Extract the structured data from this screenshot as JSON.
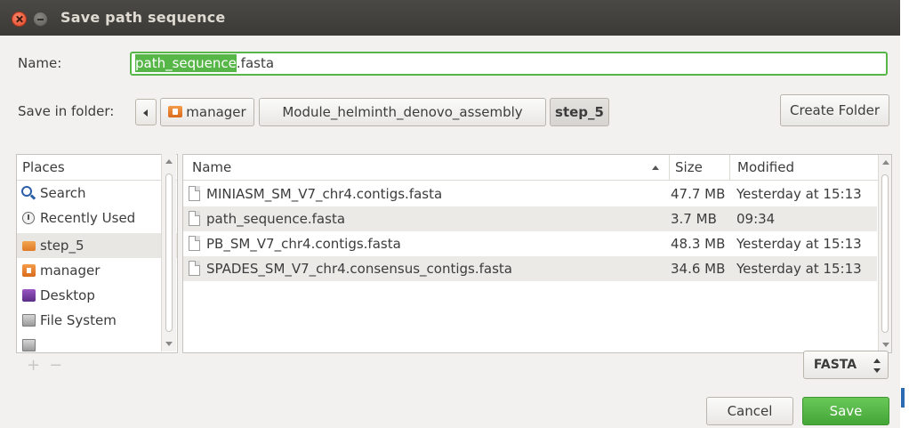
{
  "window": {
    "title": "Save path sequence"
  },
  "name_field": {
    "label": "Name:",
    "selected_part": "path_sequence",
    "rest": ".fasta"
  },
  "folder": {
    "label": "Save in folder:",
    "crumbs": [
      "manager",
      "Module_helminth_denovo_assembly",
      "step_5"
    ],
    "create_folder_label": "Create Folder"
  },
  "places": {
    "header": "Places",
    "items": [
      {
        "label": "Search",
        "icon": "search-icon"
      },
      {
        "label": "Recently Used",
        "icon": "recent-icon"
      },
      {
        "label": "step_5",
        "icon": "folder-icon"
      },
      {
        "label": "manager",
        "icon": "home-folder-icon"
      },
      {
        "label": "Desktop",
        "icon": "desktop-icon"
      },
      {
        "label": "File System",
        "icon": "drive-icon"
      }
    ]
  },
  "files": {
    "headers": {
      "name": "Name",
      "size": "Size",
      "modified": "Modified"
    },
    "rows": [
      {
        "name": "MINIASM_SM_V7_chr4.contigs.fasta",
        "size": "47.7 MB",
        "modified": "Yesterday at 15:13"
      },
      {
        "name": "path_sequence.fasta",
        "size": "3.7 MB",
        "modified": "09:34"
      },
      {
        "name": "PB_SM_V7_chr4.contigs.fasta",
        "size": "48.3 MB",
        "modified": "Yesterday at 15:13"
      },
      {
        "name": "SPADES_SM_V7_chr4.consensus_contigs.fasta",
        "size": "34.6 MB",
        "modified": "Yesterday at 15:13"
      }
    ]
  },
  "filter": {
    "value": "FASTA"
  },
  "buttons": {
    "cancel": "Cancel",
    "save": "Save"
  },
  "colors": {
    "accent_green": "#57b648",
    "titlebar": "#3f3e3a"
  }
}
